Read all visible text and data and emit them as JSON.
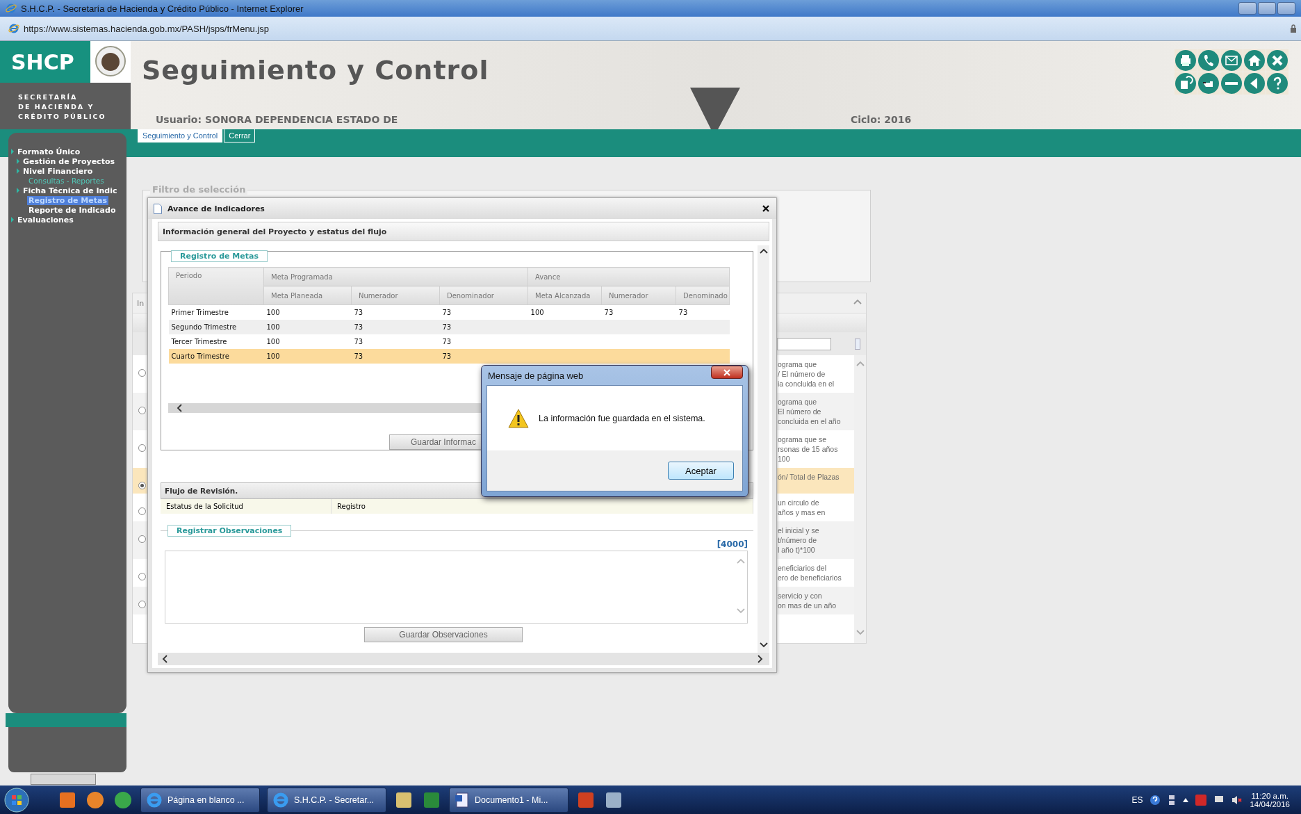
{
  "browser": {
    "title": "S.H.C.P. - Secretaría de Hacienda y Crédito Público - Internet Explorer",
    "url": "https://www.sistemas.hacienda.gob.mx/PASH/jsps/frMenu.jsp"
  },
  "header": {
    "logo": "SHCP",
    "agency_lines": [
      "SECRETARÍA",
      "DE HACIENDA Y",
      "CRÉDITO PÚBLICO"
    ],
    "title": "Seguimiento y Control",
    "user": "Usuario: SONORA DEPENDENCIA ESTADO DE",
    "cycle": "Ciclo: 2016"
  },
  "tabs": [
    {
      "label": "Seguimiento y Control",
      "selected": true
    },
    {
      "label": "Cerrar",
      "selected": false
    }
  ],
  "sidebar": {
    "items": [
      {
        "label": "Formato Único",
        "kind": "section",
        "selected": false,
        "children": [
          {
            "label": "Gestión de Proyectos",
            "kind": "section",
            "selected": false
          },
          {
            "label": "Nivel Financiero",
            "kind": "section",
            "selected": false,
            "children": [
              {
                "label": "Consultas - Reportes",
                "kind": "link",
                "selected": false
              }
            ]
          },
          {
            "label": "Ficha Técnica de Indic",
            "kind": "section",
            "selected": false,
            "children": [
              {
                "label": "Registro de Metas",
                "kind": "page",
                "selected": true
              },
              {
                "label": "Reporte de Indicado",
                "kind": "page",
                "selected": false
              }
            ]
          }
        ]
      },
      {
        "label": "Evaluaciones",
        "kind": "section",
        "selected": false
      }
    ]
  },
  "filter": {
    "legend": "Filtro de selección"
  },
  "indicator_list": {
    "column_1": "In",
    "rows": [
      {
        "selected": false,
        "lines": [
          "ograma que",
          "/ El número de",
          "ia concluida en el"
        ]
      },
      {
        "selected": false,
        "lines": [
          "ograma que",
          "El número de",
          "concluida en el año"
        ]
      },
      {
        "selected": false,
        "lines": [
          "ograma que se",
          "rsonas de 15 años",
          "100"
        ]
      },
      {
        "selected": true,
        "lines": [
          "ón/ Total de Plazas"
        ]
      },
      {
        "selected": false,
        "lines": [
          "un circulo de",
          "años y mas en"
        ]
      },
      {
        "selected": false,
        "lines": [
          "el inicial y se",
          "t/número de",
          "l año t)*100"
        ]
      },
      {
        "selected": false,
        "lines": [
          "eneficiarios del",
          "ero de beneficiarios"
        ]
      },
      {
        "selected": false,
        "lines": [
          "servicio y con",
          "on mas de un año"
        ]
      }
    ]
  },
  "dialog": {
    "title": "Avance de Indicadores",
    "section_title": "Información general del Proyecto y estatus del flujo",
    "goals": {
      "legend": "Registro de Metas",
      "group_headers": [
        "Meta Programada",
        "Avance"
      ],
      "columns": [
        "Periodo",
        "Meta Planeada",
        "Numerador",
        "Denominador",
        "Meta Alcanzada",
        "Numerador",
        "Denominado"
      ],
      "rows": [
        {
          "selected": false,
          "cells": [
            "Primer Trimestre",
            "100",
            "73",
            "73",
            "100",
            "73",
            "73"
          ]
        },
        {
          "selected": false,
          "cells": [
            "Segundo Trimestre",
            "100",
            "73",
            "73"
          ]
        },
        {
          "selected": false,
          "cells": [
            "Tercer Trimestre",
            "100",
            "73",
            "73"
          ]
        },
        {
          "selected": true,
          "cells": [
            "Cuarto Trimestre",
            "100",
            "73",
            "73"
          ]
        }
      ],
      "save_button": "Guardar Informac"
    },
    "review": {
      "title": "Flujo de Revisión.",
      "status_label": "Estatus de la Solicitud",
      "status_value": "Registro"
    },
    "observations": {
      "legend": "Registrar Observaciones",
      "counter": "[4000]",
      "save_button": "Guardar Observaciones"
    }
  },
  "message_box": {
    "title": "Mensaje de página web",
    "message": "La información fue guardada en el sistema.",
    "button": "Aceptar"
  },
  "taskbar": {
    "windows": [
      {
        "label": "Página en blanco ..."
      },
      {
        "label": "S.H.C.P. - Secretar..."
      },
      {
        "label": "Documento1 - Mi..."
      }
    ],
    "language": "ES",
    "time": "11:20 a.m.",
    "date": "14/04/2016"
  }
}
